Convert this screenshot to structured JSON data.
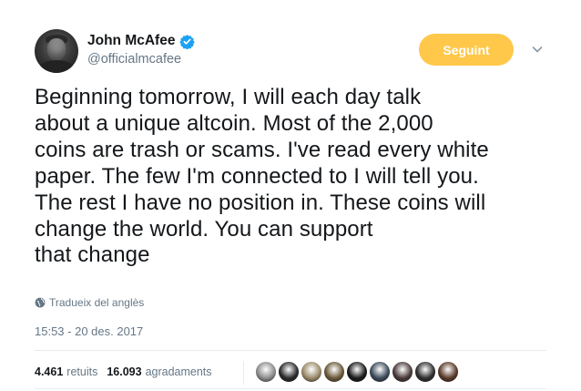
{
  "user": {
    "display_name": "John McAfee",
    "handle": "@officialmcafee"
  },
  "follow_button": {
    "label": "Seguint"
  },
  "tweet": {
    "text": "Beginning tomorrow, I will each day talk\nabout a unique altcoin. Most of the 2,000\ncoins are trash or scams. I've read every white\npaper. The few I'm connected to I will tell you.\nThe rest I have no position in. These coins will\nchange the world. You can support\n that change",
    "translate_label": "Tradueix del anglès",
    "timestamp": "15:53 - 20 des. 2017"
  },
  "stats": {
    "retweets_count": "4.461",
    "retweets_label": "retuits",
    "likes_count": "16.093",
    "likes_label": "agradaments"
  },
  "likers": [
    {
      "color": "#8c8c8c"
    },
    {
      "color": "#2b2b2b"
    },
    {
      "color": "#9a8a6a"
    },
    {
      "color": "#6b5a3a"
    },
    {
      "color": "#1a1a1a"
    },
    {
      "color": "#3c4a5a"
    },
    {
      "color": "#4a3a3a"
    },
    {
      "color": "#2f2f2f"
    },
    {
      "color": "#5a3a2a"
    }
  ],
  "colors": {
    "follow_button": "#ffc84a",
    "verified": "#1da1f2",
    "secondary_text": "#657786"
  }
}
